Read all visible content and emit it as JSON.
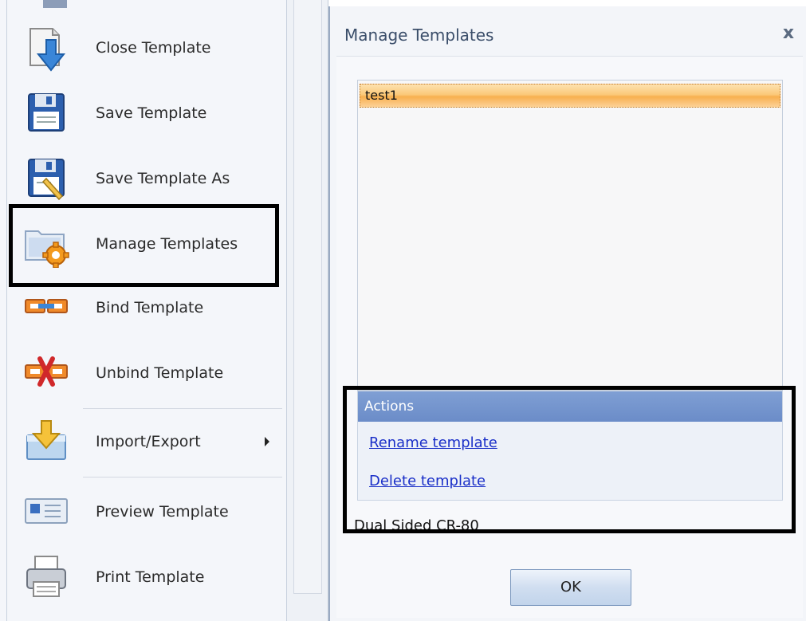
{
  "menu": {
    "items": [
      {
        "label": "Close Template",
        "icon": "close-template-icon"
      },
      {
        "label": "Save Template",
        "icon": "save-icon"
      },
      {
        "label": "Save Template As",
        "icon": "save-as-icon"
      },
      {
        "label": "Manage Templates",
        "icon": "manage-templates-icon"
      },
      {
        "label": "Bind Template",
        "icon": "bind-icon"
      },
      {
        "label": "Unbind Template",
        "icon": "unbind-icon"
      },
      {
        "label": "Import/Export",
        "icon": "import-export-icon"
      },
      {
        "label": "Preview Template",
        "icon": "preview-icon"
      },
      {
        "label": "Print Template",
        "icon": "printer-icon"
      }
    ]
  },
  "dialog": {
    "title": "Manage Templates",
    "close_glyph": "x",
    "templates": [
      "test1"
    ],
    "actions": {
      "header": "Actions",
      "rename": "Rename template",
      "delete": "Delete template"
    },
    "card_type": "Dual Sided CR-80",
    "ok_label": "OK"
  },
  "colors": {
    "selection": "#f8b04f",
    "actions_header": "#6b8cc8",
    "link": "#1a2fc8",
    "highlight_box": "#000000"
  }
}
